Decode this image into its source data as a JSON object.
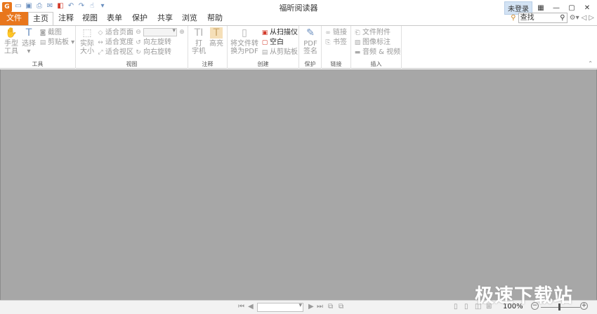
{
  "app": {
    "title": "福昕阅读器",
    "logo_glyph": "G"
  },
  "quick_access": [
    {
      "name": "open-icon",
      "glyph": "▭"
    },
    {
      "name": "save-icon",
      "glyph": "▣"
    },
    {
      "name": "print-icon",
      "glyph": "⎙"
    },
    {
      "name": "email-icon",
      "glyph": "✉"
    },
    {
      "name": "pdf-icon",
      "glyph": "◧"
    },
    {
      "name": "undo-icon",
      "glyph": "↶"
    },
    {
      "name": "redo-icon",
      "glyph": "↷"
    },
    {
      "name": "hand-tool-icon",
      "glyph": "☝"
    },
    {
      "name": "customize-icon",
      "glyph": "▾"
    }
  ],
  "window": {
    "login": "未登录"
  },
  "tabs": [
    "文件",
    "主页",
    "注释",
    "视图",
    "表单",
    "保护",
    "共享",
    "浏览",
    "帮助"
  ],
  "search": {
    "placeholder": "查找"
  },
  "ribbon": {
    "groups": {
      "tools": "工具",
      "view": "视图",
      "comment": "注释",
      "create": "创建",
      "protect": "保护",
      "links": "链接",
      "insert": "插入"
    },
    "tools": {
      "hand_line1": "手型",
      "hand_line2": "工具",
      "select": "选择",
      "snapshot": "截图",
      "clipboard": "剪贴板"
    },
    "view": {
      "actual_line1": "实际",
      "actual_line2": "大小",
      "fit_page": "适合页面",
      "fit_width": "适合宽度",
      "fit_visible": "适合视区",
      "rotate_left": "向左旋转",
      "rotate_right": "向右旋转"
    },
    "comment": {
      "typewriter_line1": "打",
      "typewriter_line2": "字机",
      "highlight": "高亮"
    },
    "create": {
      "convert_line1": "将文件转",
      "convert_line2": "换为PDF",
      "from_scanner": "从扫描仪",
      "blank": "空白",
      "from_clipboard": "从剪贴板"
    },
    "protect": {
      "sign_line1": "PDF",
      "sign_line2": "签名"
    },
    "links": {
      "link": "链接",
      "bookmark": "书签"
    },
    "insert": {
      "attachment": "文件附件",
      "image": "图像标注",
      "audio_video": "音频 & 视频"
    }
  },
  "status": {
    "zoom": "100%"
  },
  "watermark": "极速下载站"
}
